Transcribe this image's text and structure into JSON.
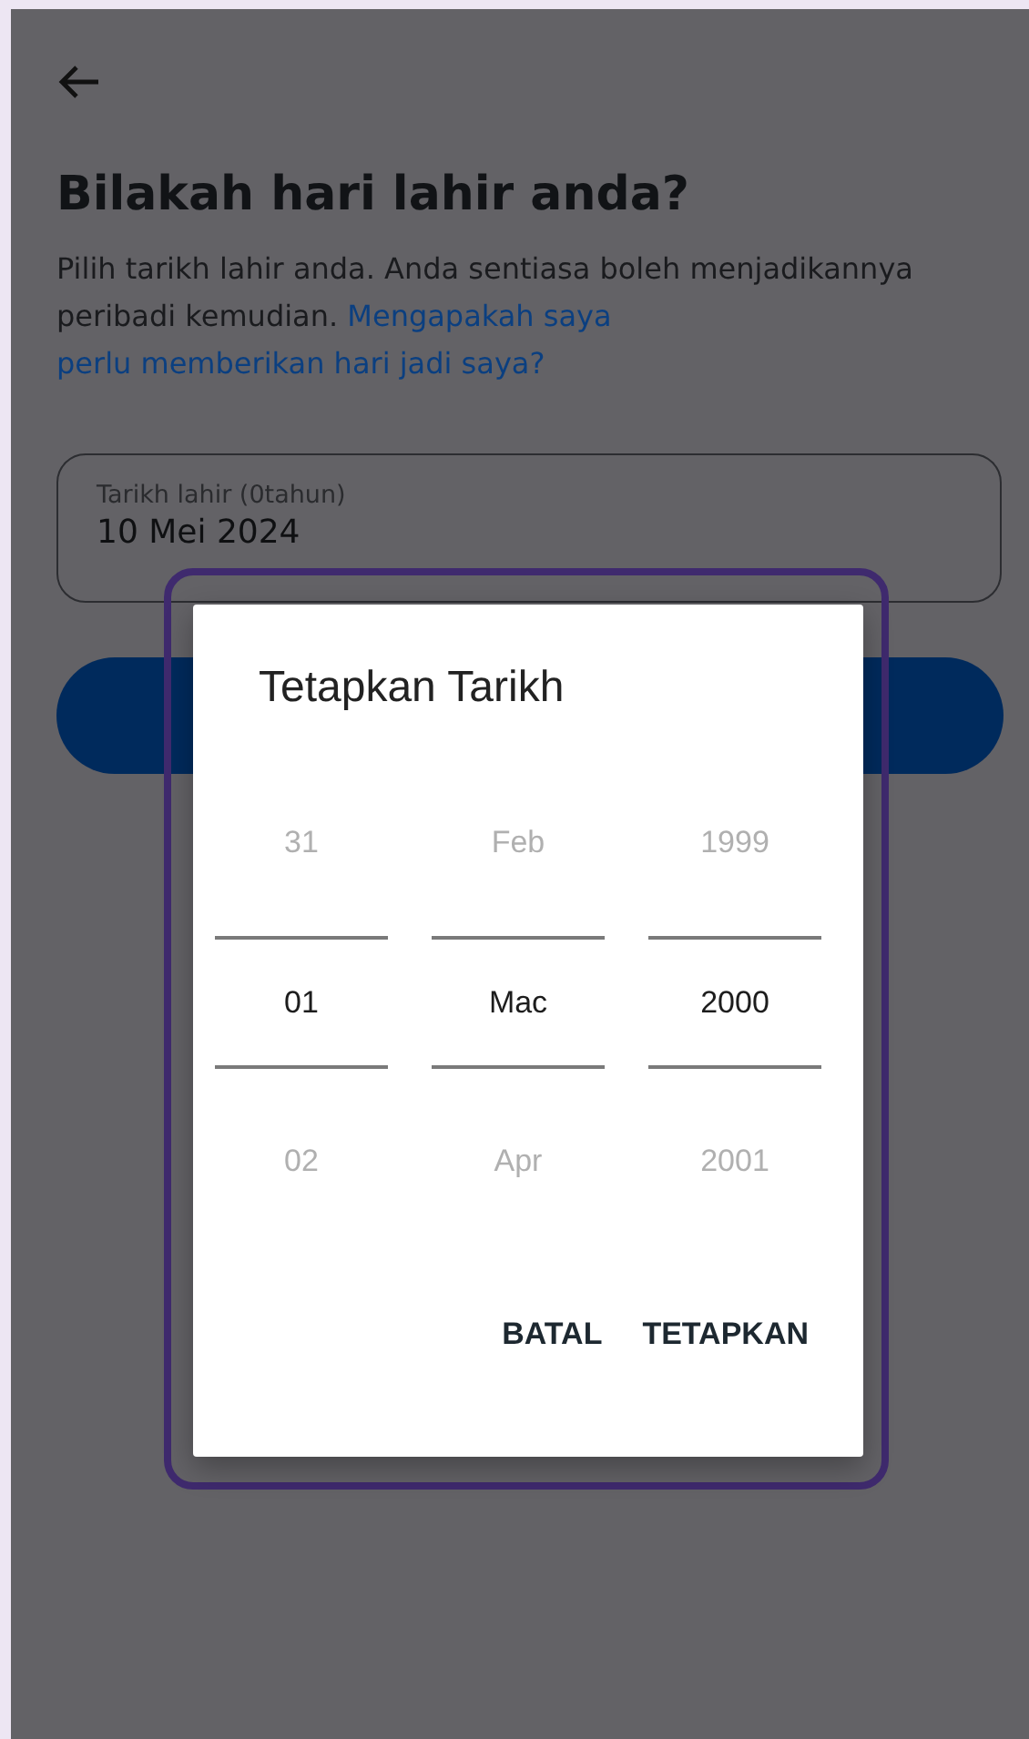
{
  "title": "Bilakah hari lahir anda?",
  "description": {
    "text": "Pilih tarikh lahir anda. Anda sentiasa boleh menjadikannya peribadi kemudian.",
    "link_lines": [
      "Mengapakah saya",
      "perlu memberikan hari jadi saya?"
    ]
  },
  "birthday_field": {
    "label": "Tarikh lahir (0tahun)",
    "value": "10 Mei 2024"
  },
  "dialog": {
    "title": "Tetapkan Tarikh",
    "columns": [
      {
        "items": [
          {
            "label": "31",
            "selected": false
          },
          {
            "label": "01",
            "selected": true
          },
          {
            "label": "02",
            "selected": false
          }
        ]
      },
      {
        "items": [
          {
            "label": "Feb",
            "selected": false
          },
          {
            "label": "Mac",
            "selected": true
          },
          {
            "label": "Apr",
            "selected": false
          }
        ]
      },
      {
        "items": [
          {
            "label": "1999",
            "selected": false
          },
          {
            "label": "2000",
            "selected": true
          },
          {
            "label": "2001",
            "selected": false
          }
        ]
      }
    ],
    "buttons": [
      "BATAL",
      "TETAPKAN"
    ]
  }
}
